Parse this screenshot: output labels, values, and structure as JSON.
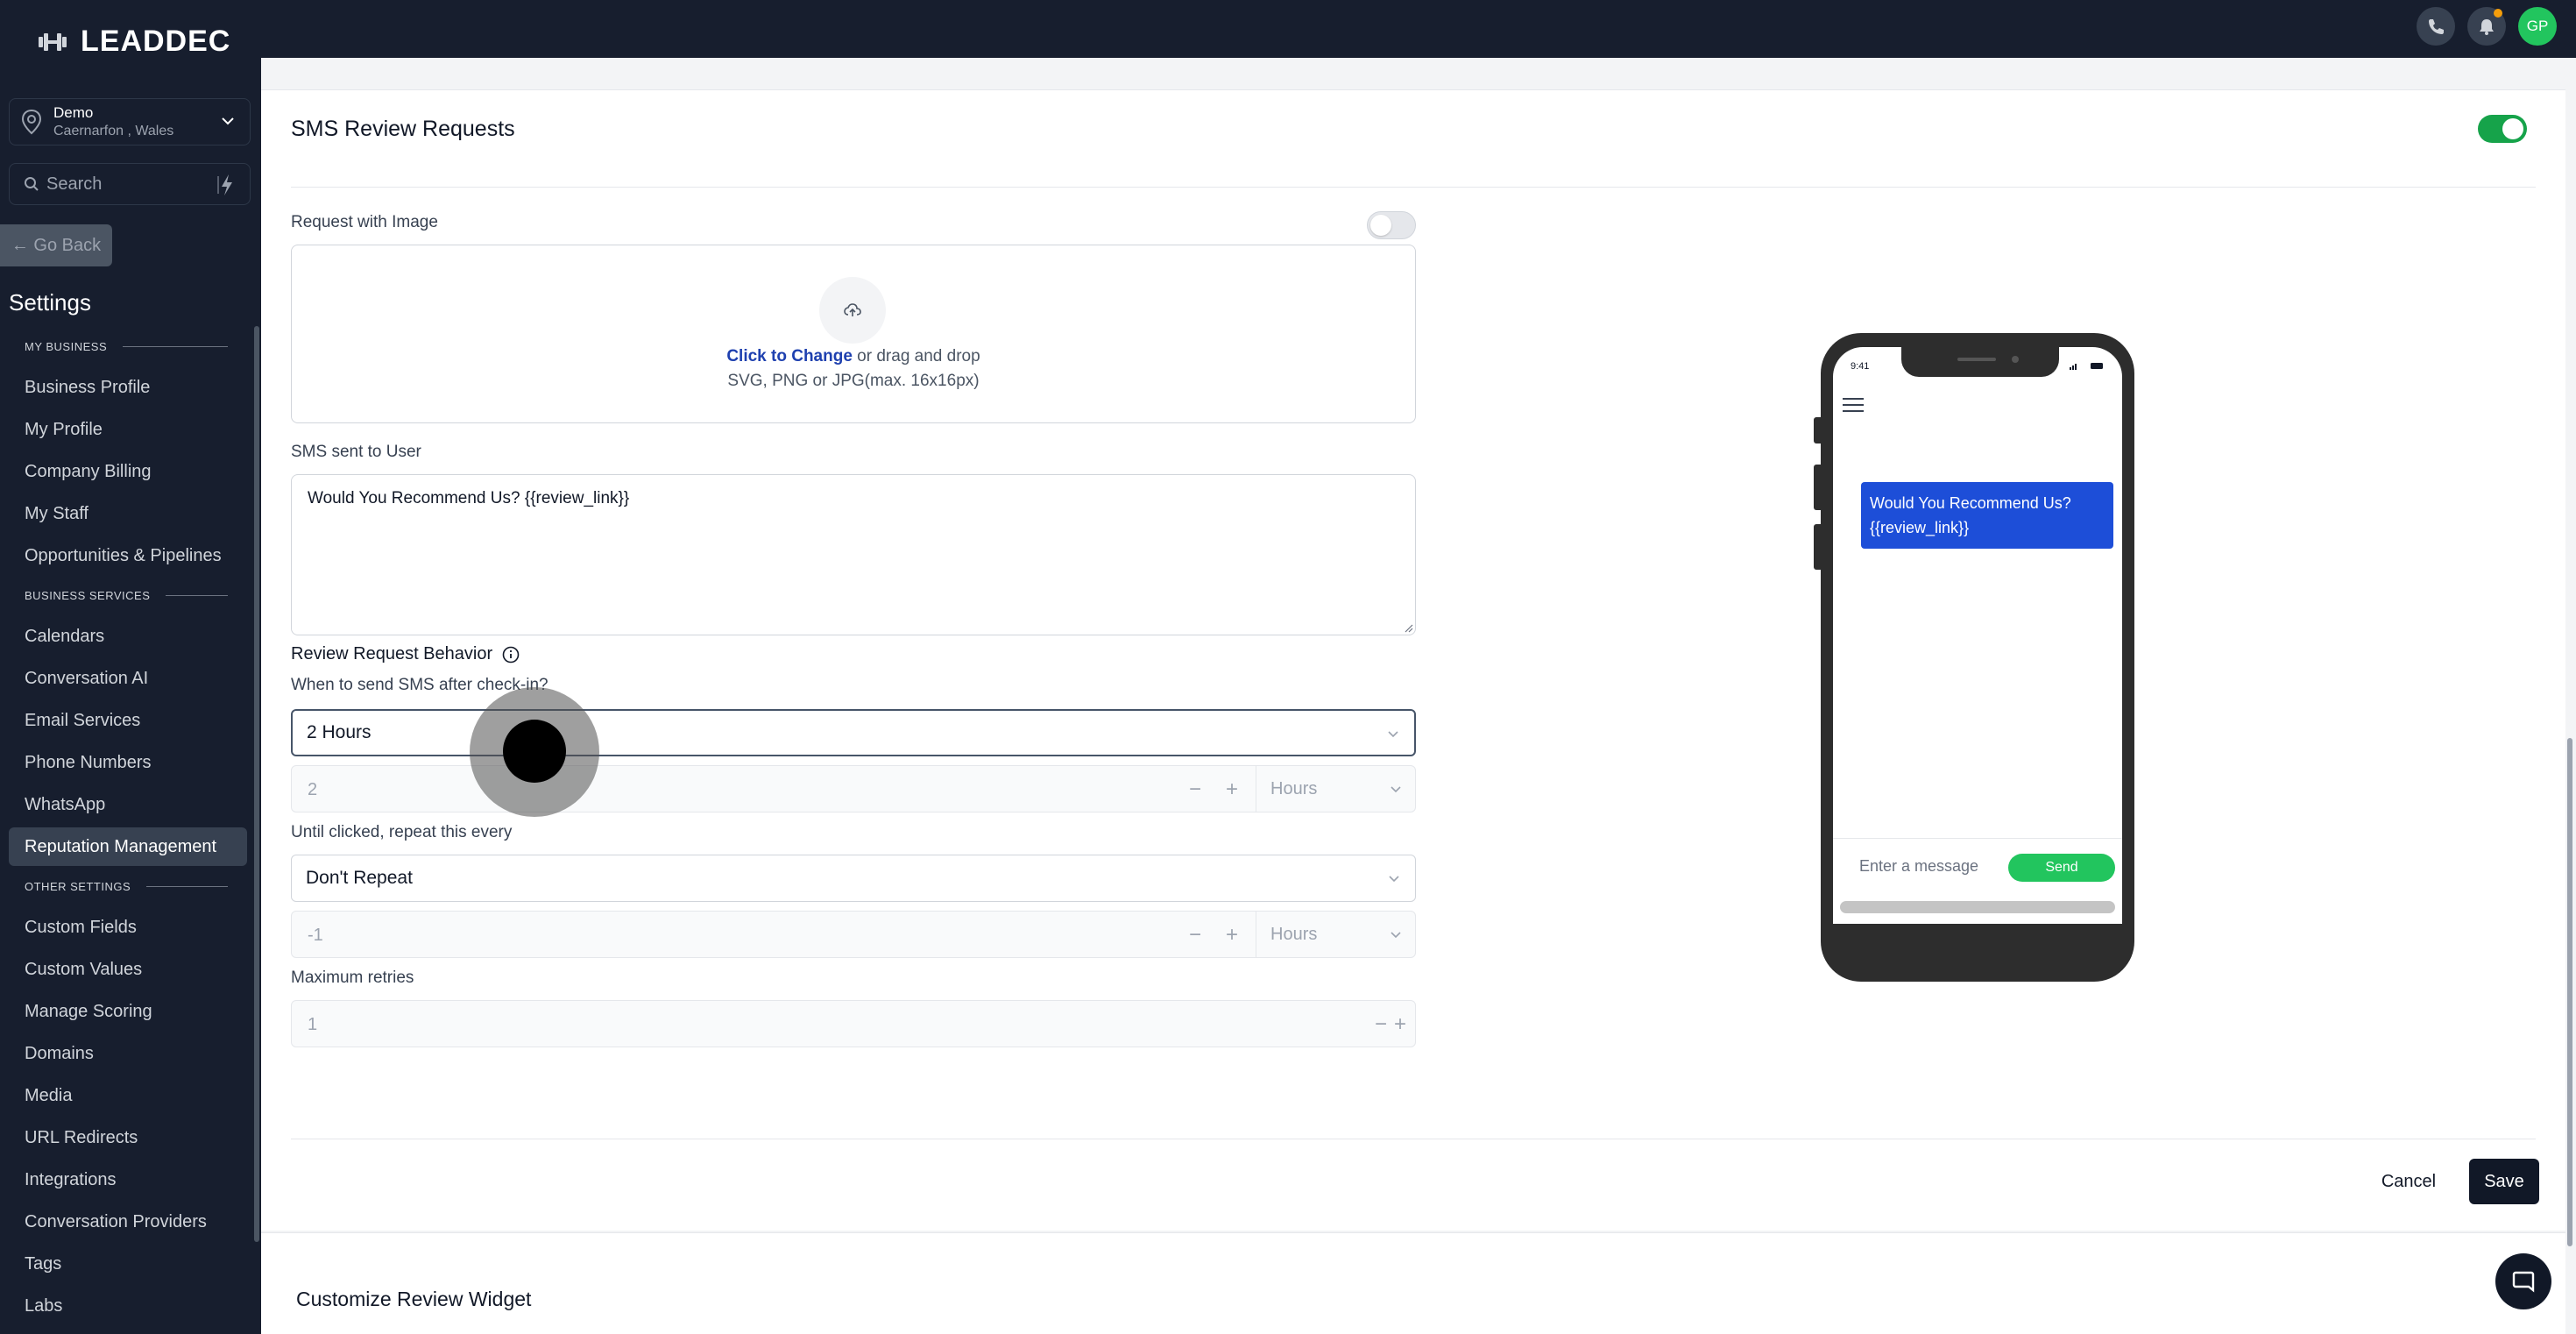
{
  "brand": {
    "name": "LEADDEC"
  },
  "location": {
    "name": "Demo",
    "sub": "Caernarfon , Wales"
  },
  "search": {
    "placeholder": "Search"
  },
  "nav": {
    "go_back": "← Go Back",
    "settings_title": "Settings",
    "sections": {
      "my_business": "MY BUSINESS",
      "business_services": "BUSINESS SERVICES",
      "other_settings": "OTHER SETTINGS"
    },
    "items": [
      "Business Profile",
      "My Profile",
      "Company Billing",
      "My Staff",
      "Opportunities & Pipelines",
      "Calendars",
      "Conversation AI",
      "Email Services",
      "Phone Numbers",
      "WhatsApp",
      "Reputation Management",
      "Custom Fields",
      "Custom Values",
      "Manage Scoring",
      "Domains",
      "Media",
      "URL Redirects",
      "Integrations",
      "Conversation Providers",
      "Tags",
      "Labs"
    ],
    "active": "Reputation Management"
  },
  "topbar": {
    "avatar_initials": "GP"
  },
  "sms_review": {
    "title": "SMS Review Requests",
    "enabled": true,
    "request_with_image_label": "Request with Image",
    "request_with_image_enabled": false,
    "upload_link": "Click to Change",
    "upload_text": " or drag and drop",
    "upload_hint": "SVG, PNG or JPG(max. 16x16px)",
    "sms_label": "SMS sent to User",
    "sms_text": "Would You Recommend Us? {{review_link}}",
    "behavior_label": "Review Request Behavior",
    "when_label": "When to send SMS after check-in?",
    "when_value": "2 Hours",
    "when_custom_value": "2",
    "when_custom_unit": "Hours",
    "repeat_label": "Until clicked, repeat this every",
    "repeat_value": "Don't Repeat",
    "repeat_custom_value": "-1",
    "repeat_custom_unit": "Hours",
    "max_retries_label": "Maximum retries",
    "max_retries_value": "1",
    "cancel_label": "Cancel",
    "save_label": "Save"
  },
  "phone_preview": {
    "time": "9:41",
    "message": "Would You Recommend Us? {{review_link}}",
    "input_placeholder": "Enter a message",
    "send_label": "Send"
  },
  "lower": {
    "title": "Customize Review Widget"
  },
  "colors": {
    "sidebar_bg": "#171e2e",
    "accent_green": "#16a34a",
    "bubble_blue": "#1d4ed8",
    "link_blue": "#1e40af"
  }
}
